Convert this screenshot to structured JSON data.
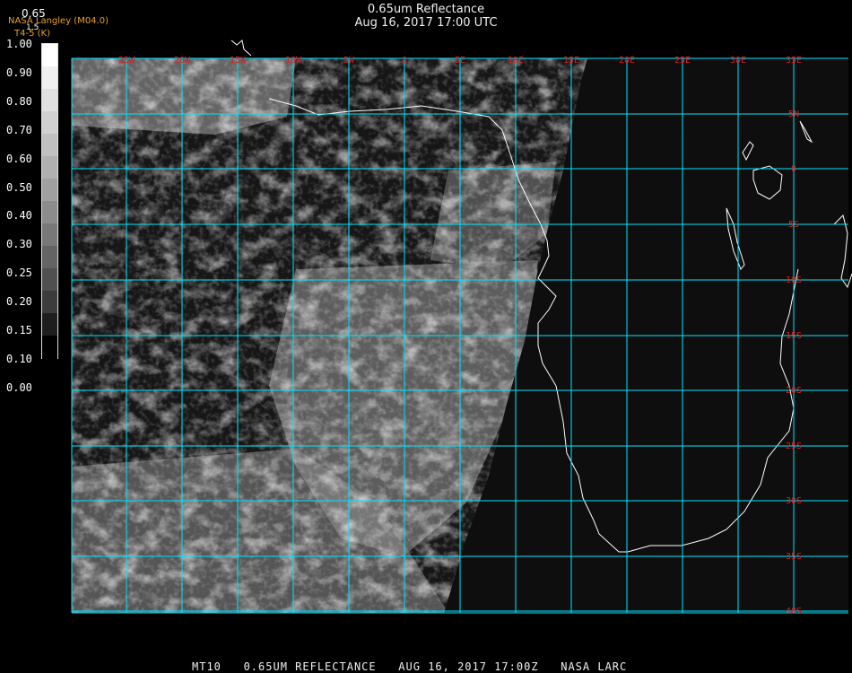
{
  "title": {
    "line1": "0.65um Reflectance",
    "line2": "Aug 16, 2017 17:00 UTC"
  },
  "organization": {
    "name": "NASA Langley (M04.0)",
    "sub": "T4-5 (K)",
    "overlap_top": "0.65",
    "overlap_mid": "1.5"
  },
  "colorbar": {
    "labels": [
      "1.00",
      "0.90",
      "0.80",
      "0.70",
      "0.60",
      "0.50",
      "0.40",
      "0.30",
      "0.25",
      "0.20",
      "0.15",
      "0.10",
      "0.00"
    ],
    "shades": [
      "#ffffff",
      "#f0f0f0",
      "#e0e0e0",
      "#d0d0d0",
      "#c0c0c0",
      "#b0b0b0",
      "#a0a0a0",
      "#8c8c8c",
      "#787878",
      "#646464",
      "#505050",
      "#3c3c3c",
      "#1e1e1e",
      "#000000"
    ]
  },
  "grid": {
    "line_color": "#00e5ff",
    "label_color": "#e02020",
    "lon_labels": [
      "25W",
      "20W",
      "15W",
      "10W",
      "5W",
      "0",
      "5E",
      "10E",
      "15E",
      "20E",
      "25E",
      "30E",
      "35E"
    ],
    "lat_labels": [
      "5N",
      "0",
      "5S",
      "10S",
      "15S",
      "20S",
      "25S",
      "30S",
      "35S",
      "40S"
    ]
  },
  "footer": "MT10   0.65UM REFLECTANCE   AUG 16, 2017 17:00Z   NASA LARC"
}
